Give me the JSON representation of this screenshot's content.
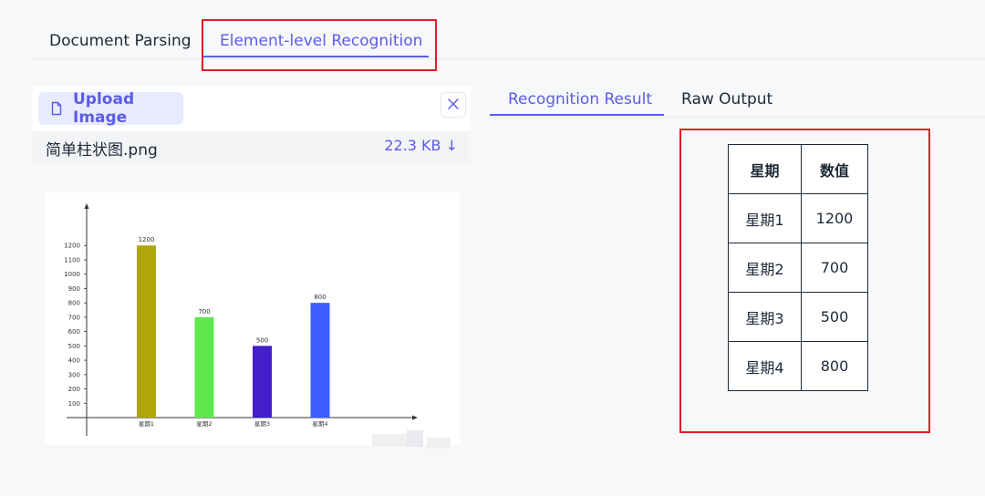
{
  "top_tabs": {
    "document_parsing": "Document Parsing",
    "element_level_recognition": "Element-level Recognition"
  },
  "upload": {
    "button_label": "Upload Image",
    "file_name": "简单柱状图.png",
    "file_size": "22.3 KB ↓"
  },
  "result_tabs": {
    "recognition_result": "Recognition Result",
    "raw_output": "Raw Output"
  },
  "result_table": {
    "headers": [
      "星期",
      "数值"
    ],
    "rows": [
      [
        "星期1",
        "1200"
      ],
      [
        "星期2",
        "700"
      ],
      [
        "星期3",
        "500"
      ],
      [
        "星期4",
        "800"
      ]
    ]
  },
  "colors": {
    "accent": "#5b5ce6",
    "highlight_red": "#e11d24"
  },
  "chart_data": {
    "type": "bar",
    "categories": [
      "星期1",
      "星期2",
      "星期3",
      "星期4"
    ],
    "values": [
      1200,
      700,
      500,
      800
    ],
    "ylim": [
      0,
      1300
    ],
    "yticks": [
      100,
      200,
      300,
      400,
      500,
      600,
      700,
      800,
      900,
      1000,
      1100,
      1200
    ],
    "colors": [
      "#b0a60a",
      "#5ee84e",
      "#431ecb",
      "#3b5cff"
    ],
    "data_labels": [
      "1200",
      "700",
      "500",
      "800"
    ],
    "grid": false
  }
}
